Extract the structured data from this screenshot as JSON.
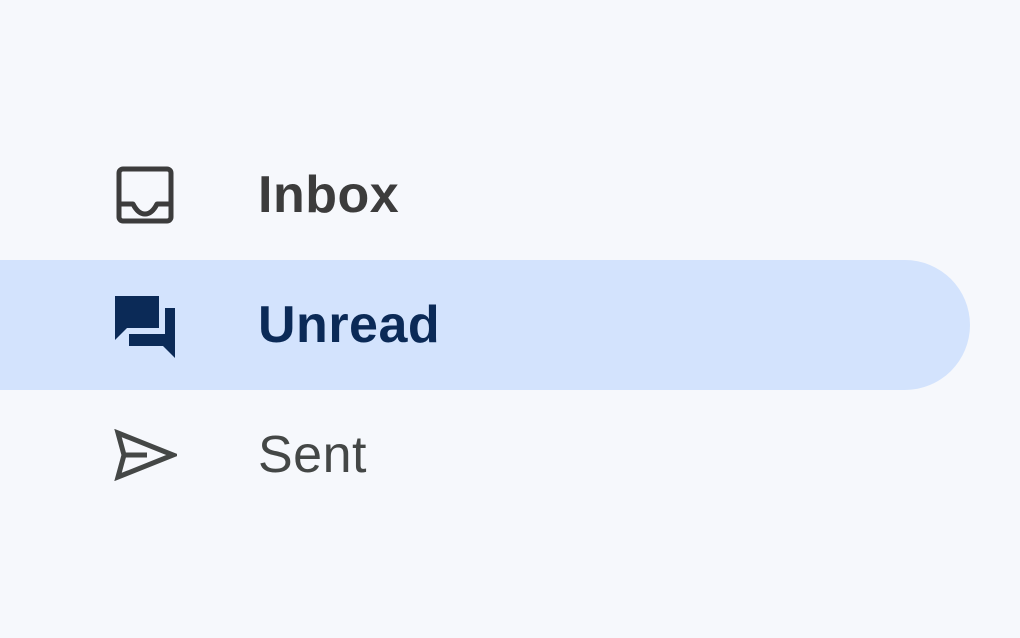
{
  "nav": {
    "items": [
      {
        "label": "Inbox",
        "icon": "inbox-icon",
        "state": "unread-bold"
      },
      {
        "label": "Unread",
        "icon": "chat-bubbles-icon",
        "state": "selected"
      },
      {
        "label": "Sent",
        "icon": "send-icon",
        "state": "normal"
      }
    ]
  },
  "colors": {
    "background": "#f6f8fc",
    "selected_background": "#d3e3fd",
    "selected_text": "#0b2a57",
    "text": "#444746"
  }
}
